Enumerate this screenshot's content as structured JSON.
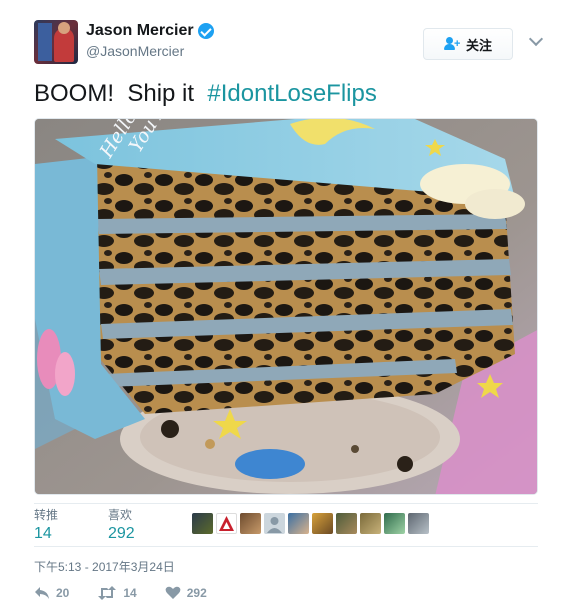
{
  "user": {
    "display_name": "Jason Mercier",
    "handle": "@JasonMercier",
    "avatar_icon": "profile-photo"
  },
  "follow_button": {
    "label": "关注",
    "icon": "add-user-icon"
  },
  "tweet": {
    "text": "BOOM!  Ship it  ",
    "hashtag": "#IdontLoseFlips",
    "media_icon": "cake-photo",
    "media_text": "Hello We W\nYou Ar"
  },
  "stats": {
    "retweets_label": "转推",
    "retweets_value": "14",
    "likes_label": "喜欢",
    "likes_value": "292",
    "liker_count": 10
  },
  "timestamp": "下午5:13 - 2017年3月24日",
  "actions": {
    "reply_count": "20",
    "retweet_count": "14",
    "like_count": "292"
  },
  "colors": {
    "accent": "#1da1f2",
    "hashtag": "#1b95a0",
    "muted": "#657786",
    "icon": "#8899a6"
  }
}
